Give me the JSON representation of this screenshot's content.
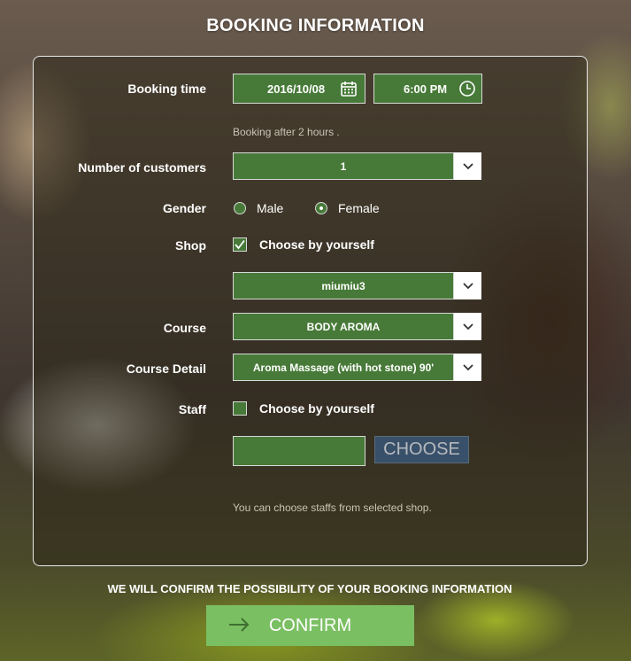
{
  "page": {
    "title": "BOOKING INFORMATION"
  },
  "form": {
    "booking_time": {
      "label": "Booking time",
      "date": "2016/10/08",
      "time": "6:00 PM",
      "hint": "Booking after 2 hours ."
    },
    "customers": {
      "label": "Number of customers",
      "value": "1"
    },
    "gender": {
      "label": "Gender",
      "options": [
        "Male",
        "Female"
      ],
      "selected": "Female"
    },
    "shop": {
      "label": "Shop",
      "checkbox_label": "Choose by yourself",
      "checked": true,
      "value": "miumiu3"
    },
    "course": {
      "label": "Course",
      "value": "BODY AROMA"
    },
    "course_detail": {
      "label": "Course Detail",
      "value": "Aroma Massage (with hot stone) 90'"
    },
    "staff": {
      "label": "Staff",
      "checkbox_label": "Choose by yourself",
      "checked": false,
      "input_value": "",
      "choose_label": "CHOOSE",
      "hint": "You can choose staffs from selected shop."
    }
  },
  "footer": {
    "notice": "WE WILL CONFIRM THE POSSIBILITY OF YOUR BOOKING INFORMATION",
    "confirm_label": "CONFIRM"
  },
  "colors": {
    "field_green": "#477a38",
    "confirm_green": "#7bbf63",
    "choose_blue": "#39506a"
  },
  "icons": [
    "calendar-icon",
    "clock-icon",
    "chevron-down-icon",
    "check-icon",
    "arrow-right-icon"
  ]
}
